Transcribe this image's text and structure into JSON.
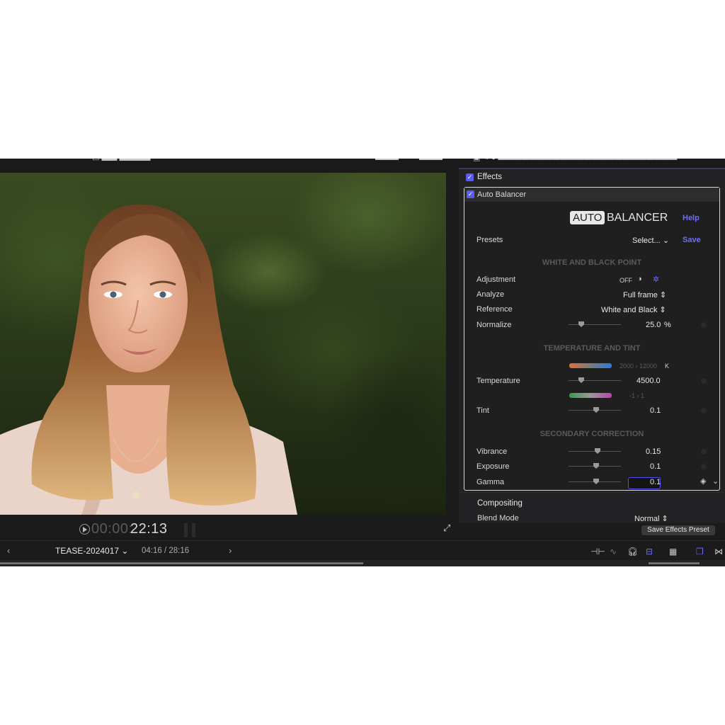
{
  "viewer": {
    "timecode_dim": "00:00:",
    "timecode": "22:13"
  },
  "inspector": {
    "effects_label": "Effects",
    "effect_name": "Auto Balancer",
    "logo_auto": "AUTO",
    "logo_balancer": "BALANCER",
    "help": "Help",
    "presets_label": "Presets",
    "presets_value": "Select...",
    "save": "Save",
    "section_wb": "WHITE AND BLACK POINT",
    "adjustment_label": "Adjustment",
    "adjustment_off": "OFF",
    "analyze_label": "Analyze",
    "analyze_value": "Full frame",
    "reference_label": "Reference",
    "reference_value": "White and Black",
    "normalize_label": "Normalize",
    "normalize_value": "25.0",
    "normalize_unit": "%",
    "section_temp": "TEMPERATURE AND TINT",
    "temp_range_low": "2000",
    "temp_range_high": "12000",
    "temp_unit": "K",
    "temperature_label": "Temperature",
    "temperature_value": "4500.0",
    "tint_range_low": "-1",
    "tint_range_high": "1",
    "tint_label": "Tint",
    "tint_value": "0.1",
    "section_secondary": "SECONDARY CORRECTION",
    "vibrance_label": "Vibrance",
    "vibrance_value": "0.15",
    "exposure_label": "Exposure",
    "exposure_value": "0.1",
    "gamma_label": "Gamma",
    "gamma_value": "0.1",
    "compositing_label": "Compositing",
    "blend_mode_label": "Blend Mode",
    "blend_mode_value": "Normal",
    "save_effects_preset": "Save Effects Preset"
  },
  "timeline": {
    "project_name": "TEASE-2024017",
    "position": "04:16 / 28:16"
  },
  "colors": {
    "accent": "#5b5bf0",
    "panel_bg": "#1f1f20"
  }
}
